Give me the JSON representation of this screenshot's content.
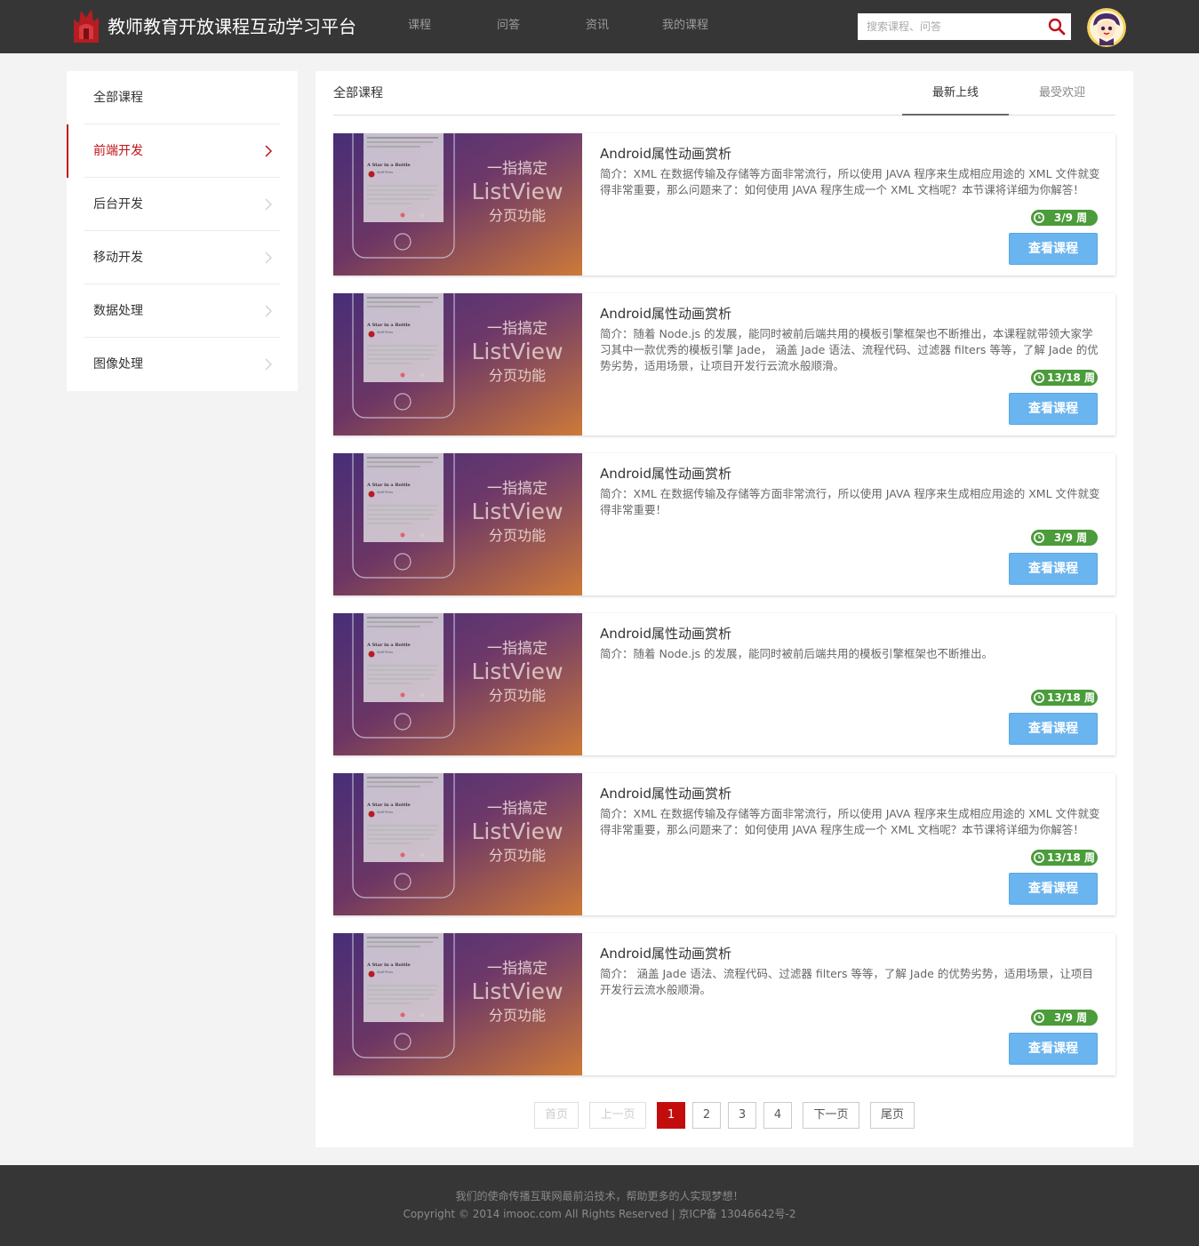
{
  "header": {
    "site_title": "教师教育开放课程互动学习平台",
    "nav": [
      {
        "label": "课程"
      },
      {
        "label": "问答"
      },
      {
        "label": "资讯"
      },
      {
        "label": "我的课程"
      }
    ],
    "search": {
      "placeholder": "搜索课程、问答",
      "value": ""
    }
  },
  "sidebar": {
    "items": [
      {
        "label": "全部课程",
        "active": false,
        "arrow": false
      },
      {
        "label": "前端开发",
        "active": true,
        "arrow": true
      },
      {
        "label": "后台开发",
        "active": false,
        "arrow": true
      },
      {
        "label": "移动开发",
        "active": false,
        "arrow": true
      },
      {
        "label": "数据处理",
        "active": false,
        "arrow": true
      },
      {
        "label": "图像处理",
        "active": false,
        "arrow": true
      }
    ]
  },
  "main": {
    "title": "全部课程",
    "tabs": [
      {
        "label": "最新上线",
        "active": true
      },
      {
        "label": "最受欢迎",
        "active": false
      }
    ],
    "thumb_text": {
      "line1": "一指搞定",
      "line2": "ListView",
      "line3": "分页功能",
      "phone_text": "A Star in a Bottle",
      "phone_sub": "Staff Picks"
    },
    "courses": [
      {
        "title": "Android属性动画赏析",
        "desc": "简介：XML 在数据传输及存储等方面非常流行，所以使用 JAVA 程序来生成相应用途的 XML 文件就变得非常重要，那么问题来了：如何使用 JAVA 程序生成一个 XML 文档呢？本节课将详细为你解答！",
        "weeks": "3/9 周",
        "button": "查看课程"
      },
      {
        "title": "Android属性动画赏析",
        "desc": "简介：随着 Node.js 的发展，能同时被前后端共用的模板引擎框架也不断推出，本课程就带领大家学习其中一款优秀的模板引擎 Jade， 涵盖 Jade 语法、流程代码、过滤器 filters 等等，了解 Jade 的优势劣势，适用场景，让项目开发行云流水般顺滑。",
        "weeks": "13/18 周",
        "button": "查看课程"
      },
      {
        "title": "Android属性动画赏析",
        "desc": "简介：XML 在数据传输及存储等方面非常流行，所以使用 JAVA 程序来生成相应用途的 XML 文件就变得非常重要！",
        "weeks": "3/9 周",
        "button": "查看课程"
      },
      {
        "title": "Android属性动画赏析",
        "desc": "简介：随着 Node.js 的发展，能同时被前后端共用的模板引擎框架也不断推出。",
        "weeks": "13/18 周",
        "button": "查看课程"
      },
      {
        "title": "Android属性动画赏析",
        "desc": "简介：XML 在数据传输及存储等方面非常流行，所以使用 JAVA 程序来生成相应用途的 XML 文件就变得非常重要，那么问题来了：如何使用 JAVA 程序生成一个 XML 文档呢？本节课将详细为你解答！",
        "weeks": "13/18 周",
        "button": "查看课程"
      },
      {
        "title": "Android属性动画赏析",
        "desc": "简介： 涵盖 Jade 语法、流程代码、过滤器 filters 等等，了解 Jade 的优势劣势，适用场景，让项目开发行云流水般顺滑。",
        "weeks": "3/9 周",
        "button": "查看课程"
      }
    ],
    "pagination": {
      "first": "首页",
      "prev": "上一页",
      "pages": [
        "1",
        "2",
        "3",
        "4"
      ],
      "current": "1",
      "next": "下一页",
      "last": "尾页"
    }
  },
  "footer": {
    "line1": "我们的使命传播互联网最前沿技术，帮助更多的人实现梦想！",
    "line2": "Copyright © 2014 imooc.com All Rights Reserved | 京ICP备 13046642号-2"
  },
  "colors": {
    "header_bg": "#363636",
    "accent_red": "#c1141b",
    "badge_green": "#4b9c3a",
    "button_blue": "#6ab4ef"
  }
}
